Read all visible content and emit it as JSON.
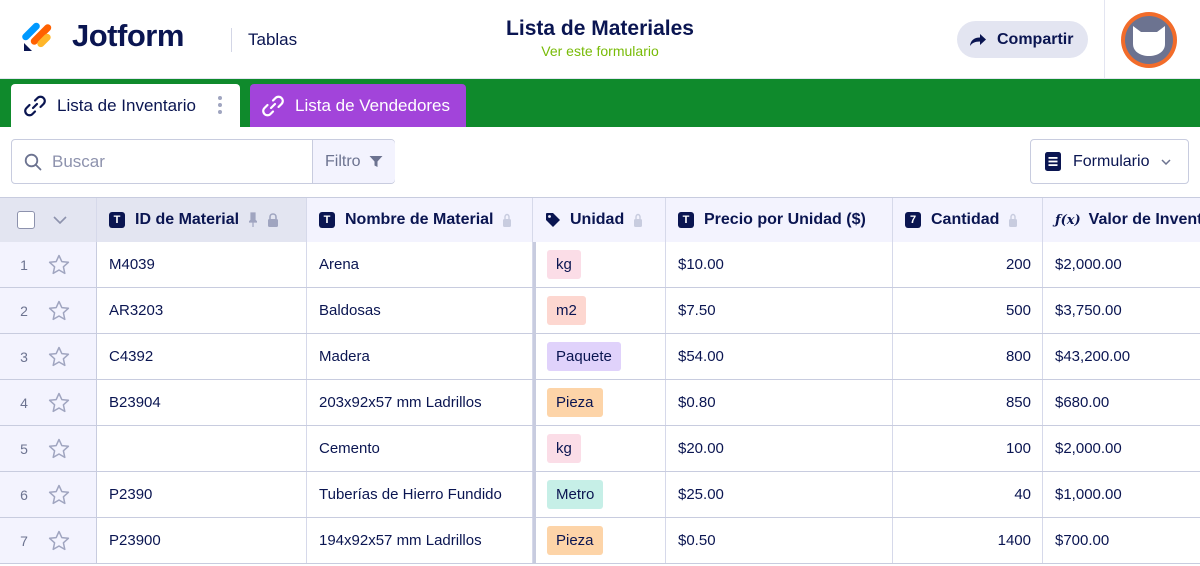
{
  "header": {
    "logo_text": "Jotform",
    "section": "Tablas",
    "title": "Lista de Materiales",
    "subtitle": "Ver este formulario",
    "share_label": "Compartir"
  },
  "tabs": [
    {
      "label": "Lista de Inventario",
      "active": true
    },
    {
      "label": "Lista de Vendedores",
      "active": false,
      "color": "#a244da"
    }
  ],
  "toolbar": {
    "search_placeholder": "Buscar",
    "filter_label": "Filtro",
    "form_label": "Formulario"
  },
  "colors": {
    "brand_navy": "#0a1551",
    "tabbar_green": "#0f8a2c",
    "subtitle_green": "#78bb07",
    "avatar_ring": "#f26c2a"
  },
  "columns": [
    {
      "label": "ID de Material",
      "icon": "T",
      "kind": "text"
    },
    {
      "label": "Nombre de Material",
      "icon": "T",
      "kind": "text"
    },
    {
      "label": "Unidad",
      "icon": "tag",
      "kind": "tag"
    },
    {
      "label": "Precio por Unidad ($)",
      "icon": "T",
      "kind": "text"
    },
    {
      "label": "Cantidad",
      "icon": "7",
      "kind": "number"
    },
    {
      "label": "Valor de Inventa",
      "icon": "f(x)",
      "kind": "formula"
    }
  ],
  "unit_colors": {
    "kg": "#fbdde7",
    "m2": "#fdd7d0",
    "Paquete": "#e0d2fb",
    "Pieza": "#fdd4a8",
    "Metro": "#c6efe7"
  },
  "rows": [
    {
      "n": "1",
      "id": "M4039",
      "name": "Arena",
      "unit": "kg",
      "price": "$10.00",
      "qty": "200",
      "value": "$2,000.00"
    },
    {
      "n": "2",
      "id": "AR3203",
      "name": "Baldosas",
      "unit": "m2",
      "price": "$7.50",
      "qty": "500",
      "value": "$3,750.00"
    },
    {
      "n": "3",
      "id": "C4392",
      "name": "Madera",
      "unit": "Paquete",
      "price": "$54.00",
      "qty": "800",
      "value": "$43,200.00"
    },
    {
      "n": "4",
      "id": "B23904",
      "name": "203x92x57 mm Ladrillos",
      "unit": "Pieza",
      "price": "$0.80",
      "qty": "850",
      "value": "$680.00"
    },
    {
      "n": "5",
      "id": "",
      "name": "Cemento",
      "unit": "kg",
      "price": "$20.00",
      "qty": "100",
      "value": "$2,000.00"
    },
    {
      "n": "6",
      "id": "P2390",
      "name": "Tuberías de Hierro Fundido",
      "unit": "Metro",
      "price": "$25.00",
      "qty": "40",
      "value": "$1,000.00"
    },
    {
      "n": "7",
      "id": "P23900",
      "name": "194x92x57 mm Ladrillos",
      "unit": "Pieza",
      "price": "$0.50",
      "qty": "1400",
      "value": "$700.00"
    }
  ]
}
